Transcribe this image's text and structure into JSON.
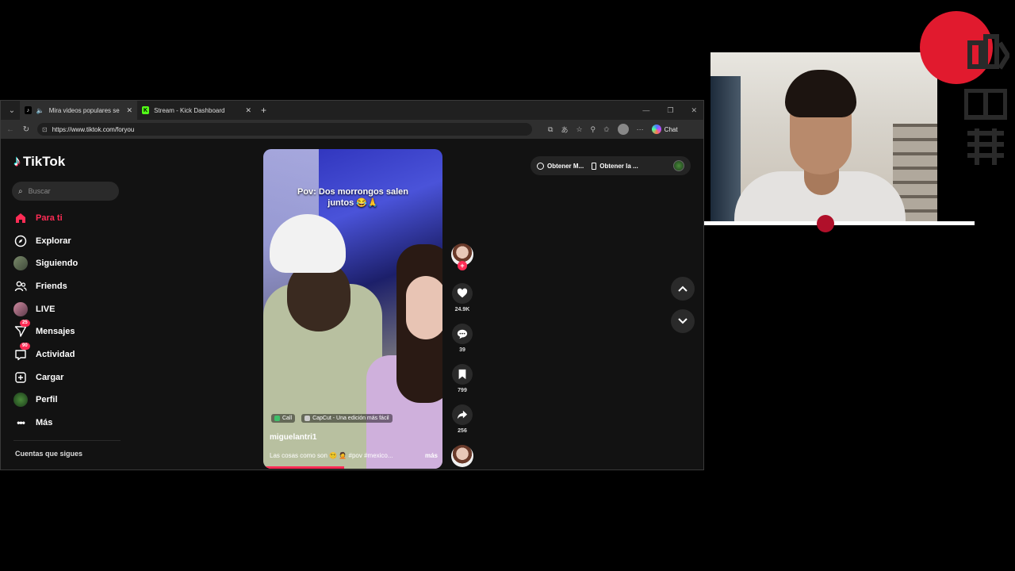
{
  "browser": {
    "tabs": [
      {
        "title": "Mira videos populares selecci",
        "favicon": "tiktok-icon",
        "active": true
      },
      {
        "title": "Stream - Kick Dashboard",
        "favicon": "kick-icon",
        "active": false
      }
    ],
    "url": "https://www.tiktok.com/foryou",
    "copilot_label": "Chat"
  },
  "tiktok": {
    "logo_text": "TikTok",
    "search_placeholder": "Buscar",
    "nav": [
      {
        "label": "Para ti",
        "icon": "home-icon",
        "active": true
      },
      {
        "label": "Explorar",
        "icon": "compass-icon"
      },
      {
        "label": "Siguiendo",
        "icon": "avatar"
      },
      {
        "label": "Friends",
        "icon": "friends-icon"
      },
      {
        "label": "LIVE",
        "icon": "avatar"
      },
      {
        "label": "Mensajes",
        "icon": "send-icon",
        "badge": "25"
      },
      {
        "label": "Actividad",
        "icon": "inbox-icon",
        "badge": "90"
      },
      {
        "label": "Cargar",
        "icon": "upload-icon"
      },
      {
        "label": "Perfil",
        "icon": "avatar"
      },
      {
        "label": "Más",
        "icon": "more-icon"
      }
    ],
    "following_title": "Cuentas que sigues",
    "chips": [
      "Obtener M...",
      "Obtener la ..."
    ],
    "video": {
      "overlay_text": "Pov: Dos morrongos salen juntos 😂🙏",
      "tags": [
        "Call",
        "CapCut - Una edición más fácil"
      ],
      "username": "miguelantri1",
      "caption": "Las cosas como son 😵‍💫 🤦 #pov #mexico...",
      "more": "más",
      "progress": 0.45
    },
    "actions": {
      "likes": "24.9K",
      "comments": "39",
      "saves": "799",
      "shares": "256"
    }
  },
  "colors": {
    "accent": "#fe2c55",
    "brand_red": "#e11a2e"
  }
}
